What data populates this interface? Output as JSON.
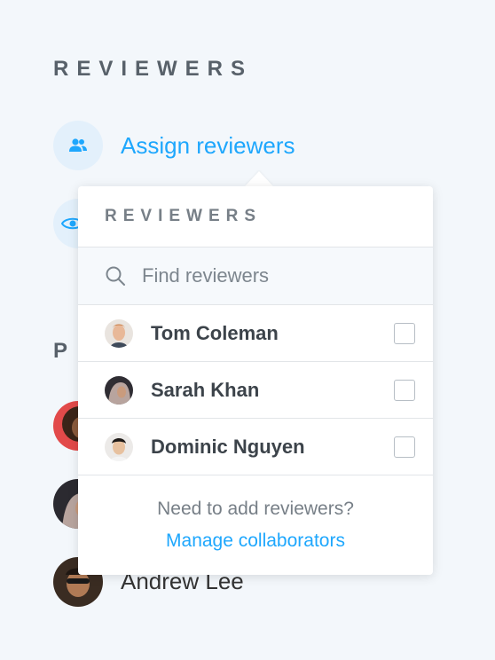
{
  "section": {
    "title": "REVIEWERS",
    "partial_title": "P"
  },
  "assign": {
    "label": "Assign reviewers",
    "icon": "users-icon"
  },
  "background": {
    "name": "Andrew Lee"
  },
  "popover": {
    "title": "REVIEWERS",
    "search": {
      "placeholder": "Find reviewers",
      "value": ""
    },
    "reviewers": [
      {
        "name": "Tom Coleman",
        "checked": false
      },
      {
        "name": "Sarah Khan",
        "checked": false
      },
      {
        "name": "Dominic Nguyen",
        "checked": false
      }
    ],
    "footer": {
      "note": "Need to add reviewers?",
      "link": "Manage collaborators"
    }
  },
  "colors": {
    "accent": "#1ea7fd",
    "background": "#f3f7fb"
  }
}
